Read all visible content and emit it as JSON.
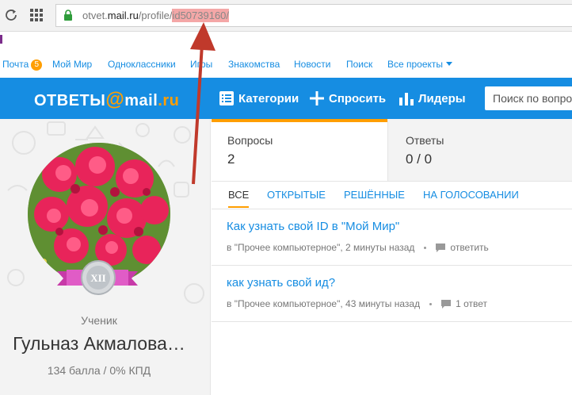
{
  "browser": {
    "url_prefix": "otvet.",
    "url_host": "mail.ru",
    "url_path": "/profile/",
    "url_highlight": "id50739160/"
  },
  "portal_menu": {
    "items": [
      {
        "label": "Почта"
      },
      {
        "label": "Мой Мир"
      },
      {
        "label": "Одноклассники"
      },
      {
        "label": "Игры"
      },
      {
        "label": "Знакомства"
      },
      {
        "label": "Новости"
      },
      {
        "label": "Поиск"
      },
      {
        "label": "Все проекты"
      }
    ],
    "mail_badge": "5"
  },
  "navbar": {
    "logo_left": "ОТВЕТЫ",
    "logo_at": "@",
    "logo_mail": "mail",
    "logo_dot_ru": ".ru",
    "categories": "Категории",
    "ask": "Спросить",
    "leaders": "Лидеры",
    "search_placeholder": "Поиск по вопросам"
  },
  "profile": {
    "rank_numeral": "XII",
    "rank": "Ученик",
    "name": "Гульназ Акмалова…",
    "points": "134 балла / 0% КПД"
  },
  "stats": {
    "questions_label": "Вопросы",
    "questions_value": "2",
    "answers_label": "Ответы",
    "answers_value": "0 / 0"
  },
  "tabs": [
    {
      "label": "Все",
      "active": true
    },
    {
      "label": "Открытые",
      "active": false
    },
    {
      "label": "Решённые",
      "active": false
    },
    {
      "label": "На голосовании",
      "active": false
    }
  ],
  "questions": [
    {
      "title": "Как узнать свой ID в \"Мой Мир\"",
      "category": "в \"Прочее компьютерное\", 2 минуты назад",
      "action": "ответить"
    },
    {
      "title": "как узнать свой ид?",
      "category": "в \"Прочее компьютерное\", 43 минуты назад",
      "action": "1 ответ"
    }
  ],
  "colors": {
    "brand_blue": "#168de2",
    "accent_orange": "#ff9e00",
    "annotation_arrow": "#c0392b"
  }
}
